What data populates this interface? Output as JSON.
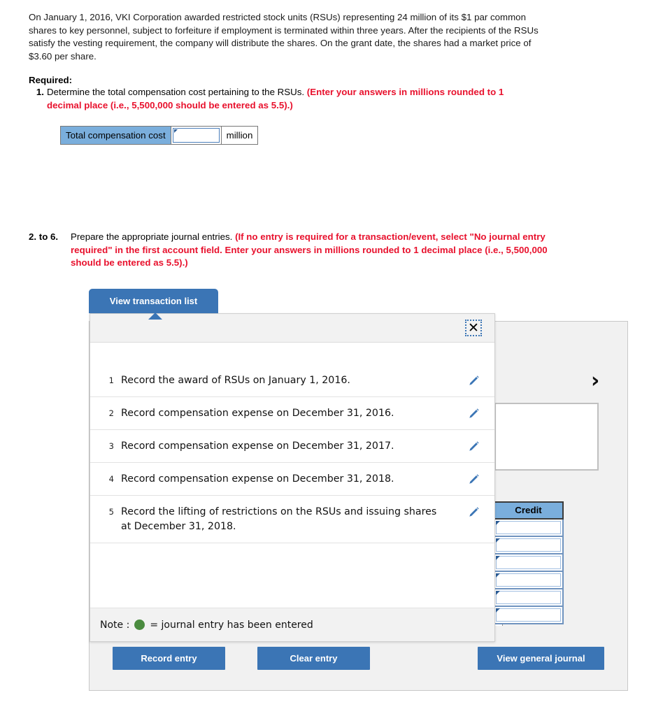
{
  "intro": {
    "paragraph": "On January 1, 2016, VKI Corporation awarded restricted stock units (RSUs) representing 24 million of its $1 par common shares to key personnel, subject to forfeiture if employment is terminated within three years. After the recipients of the RSUs satisfy the vesting requirement, the company will distribute the shares. On the grant date, the shares had a market price of $3.60 per share."
  },
  "required": {
    "heading": "Required:",
    "item1": {
      "number": "1.",
      "text": "Determine the total compensation cost pertaining to the RSUs. ",
      "instruction": "(Enter your answers in millions rounded to 1 decimal place (i.e., 5,500,000 should be entered as 5.5).)"
    },
    "item2to6": {
      "number": "2. to 6.",
      "text": "Prepare the appropriate journal entries. ",
      "instruction": "(If no entry is required for a transaction/event, select \"No journal entry required\" in the first account field. Enter your answers in millions rounded to 1 decimal place (i.e., 5,500,000 should be entered as 5.5).)"
    }
  },
  "total_compensation": {
    "label": "Total compensation cost",
    "value": "",
    "placeholder": "",
    "unit": "million",
    "label_bg": "#7aaedc"
  },
  "tab": {
    "label": "View transaction list",
    "color": "#3b75b5"
  },
  "modal": {
    "close_icon": "close-icon",
    "close_glyph": "✕",
    "transactions": [
      {
        "no": "1",
        "description": "Record the award of RSUs on January 1, 2016."
      },
      {
        "no": "2",
        "description": "Record compensation expense on December 31, 2016."
      },
      {
        "no": "3",
        "description": "Record compensation expense on December 31, 2017."
      },
      {
        "no": "4",
        "description": "Record compensation expense on December 31, 2018."
      },
      {
        "no": "5",
        "description": "Record the lifting of restrictions on the RSUs and issuing shares at December 31, 2018."
      }
    ],
    "note_prefix": "Note :",
    "note_suffix": "= journal entry has been entered",
    "note_dot_color": "#4a8b3f",
    "edit_icon": "pencil-icon"
  },
  "journal": {
    "credit_header": "Credit",
    "credit_rows": [
      "",
      "",
      "",
      "",
      "",
      ""
    ],
    "chevron_glyph": "›",
    "chevron_icon": "chevron-right-icon"
  },
  "buttons": {
    "record_entry": "Record entry",
    "clear_entry": "Clear entry",
    "view_general_journal": "View general journal"
  }
}
